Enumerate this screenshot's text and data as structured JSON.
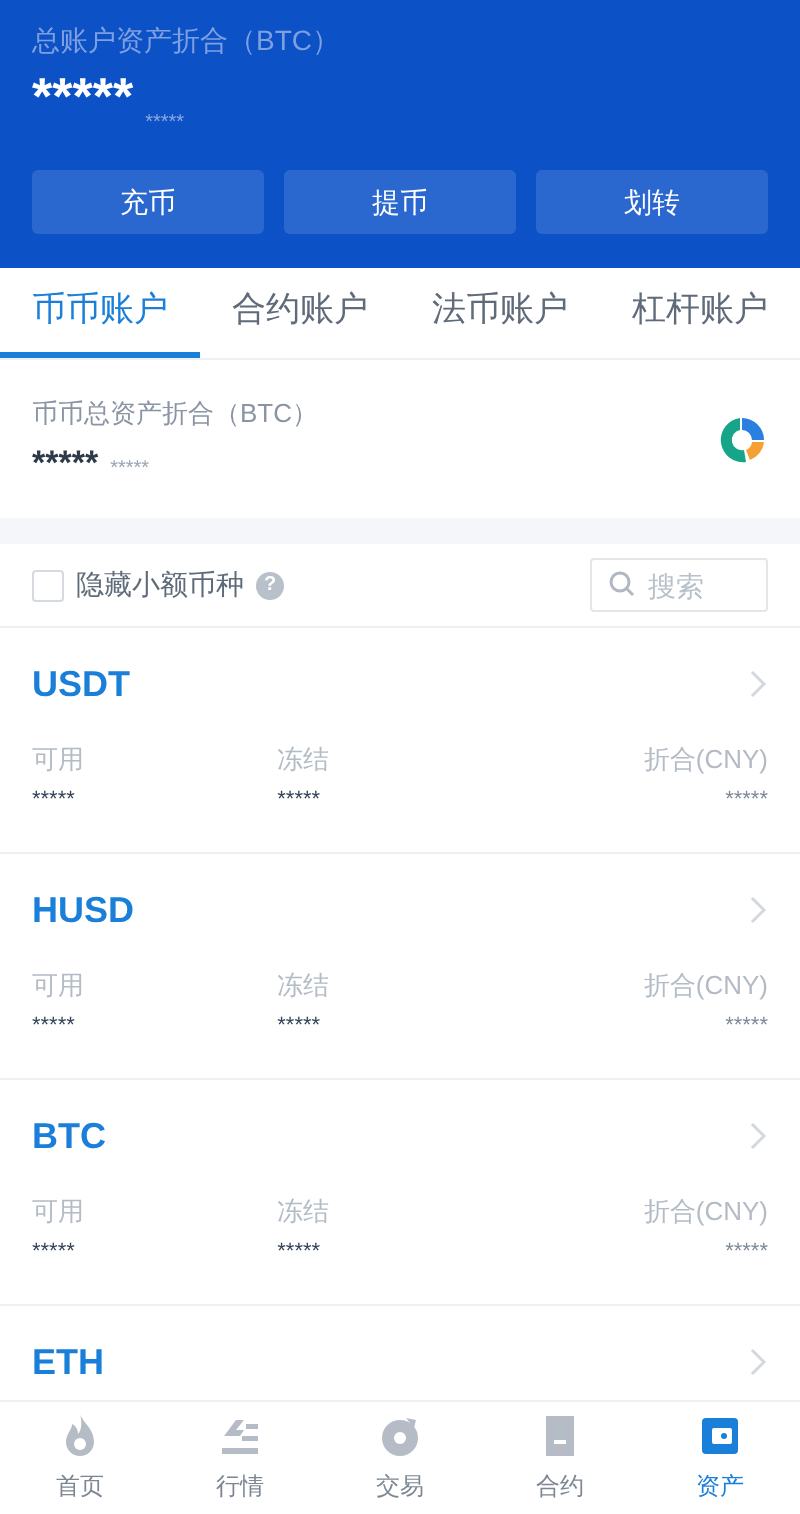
{
  "header": {
    "label": "总账户资产折合（BTC）",
    "amount": "*****",
    "sub_amount": "*****",
    "buttons": [
      "充币",
      "提币",
      "划转"
    ]
  },
  "tabs": [
    {
      "label": "币币账户",
      "selected": true
    },
    {
      "label": "合约账户",
      "selected": false
    },
    {
      "label": "法币账户",
      "selected": false
    },
    {
      "label": "杠杆账户",
      "selected": false
    }
  ],
  "summary": {
    "label": "币币总资产折合（BTC）",
    "amount": "*****",
    "sub_amount": "*****"
  },
  "filter": {
    "label": "隐藏小额币种",
    "checked": false,
    "help": "?",
    "search_placeholder": "搜索"
  },
  "coins": [
    {
      "name": "USDT",
      "fields": [
        {
          "label": "可用",
          "value": "*****"
        },
        {
          "label": "冻结",
          "value": "*****"
        },
        {
          "label": "折合(CNY)",
          "value": "*****"
        }
      ]
    },
    {
      "name": "HUSD",
      "fields": [
        {
          "label": "可用",
          "value": "*****"
        },
        {
          "label": "冻结",
          "value": "*****"
        },
        {
          "label": "折合(CNY)",
          "value": "*****"
        }
      ]
    },
    {
      "name": "BTC",
      "fields": [
        {
          "label": "可用",
          "value": "*****"
        },
        {
          "label": "冻结",
          "value": "*****"
        },
        {
          "label": "折合(CNY)",
          "value": "*****"
        }
      ]
    },
    {
      "name": "ETH"
    }
  ],
  "nav": [
    {
      "label": "首页",
      "kind": "flame",
      "selected": false
    },
    {
      "label": "行情",
      "kind": "chart",
      "selected": false
    },
    {
      "label": "交易",
      "kind": "trade",
      "selected": false
    },
    {
      "label": "合约",
      "kind": "contract",
      "selected": false
    },
    {
      "label": "资产",
      "kind": "wallet",
      "selected": true
    }
  ]
}
